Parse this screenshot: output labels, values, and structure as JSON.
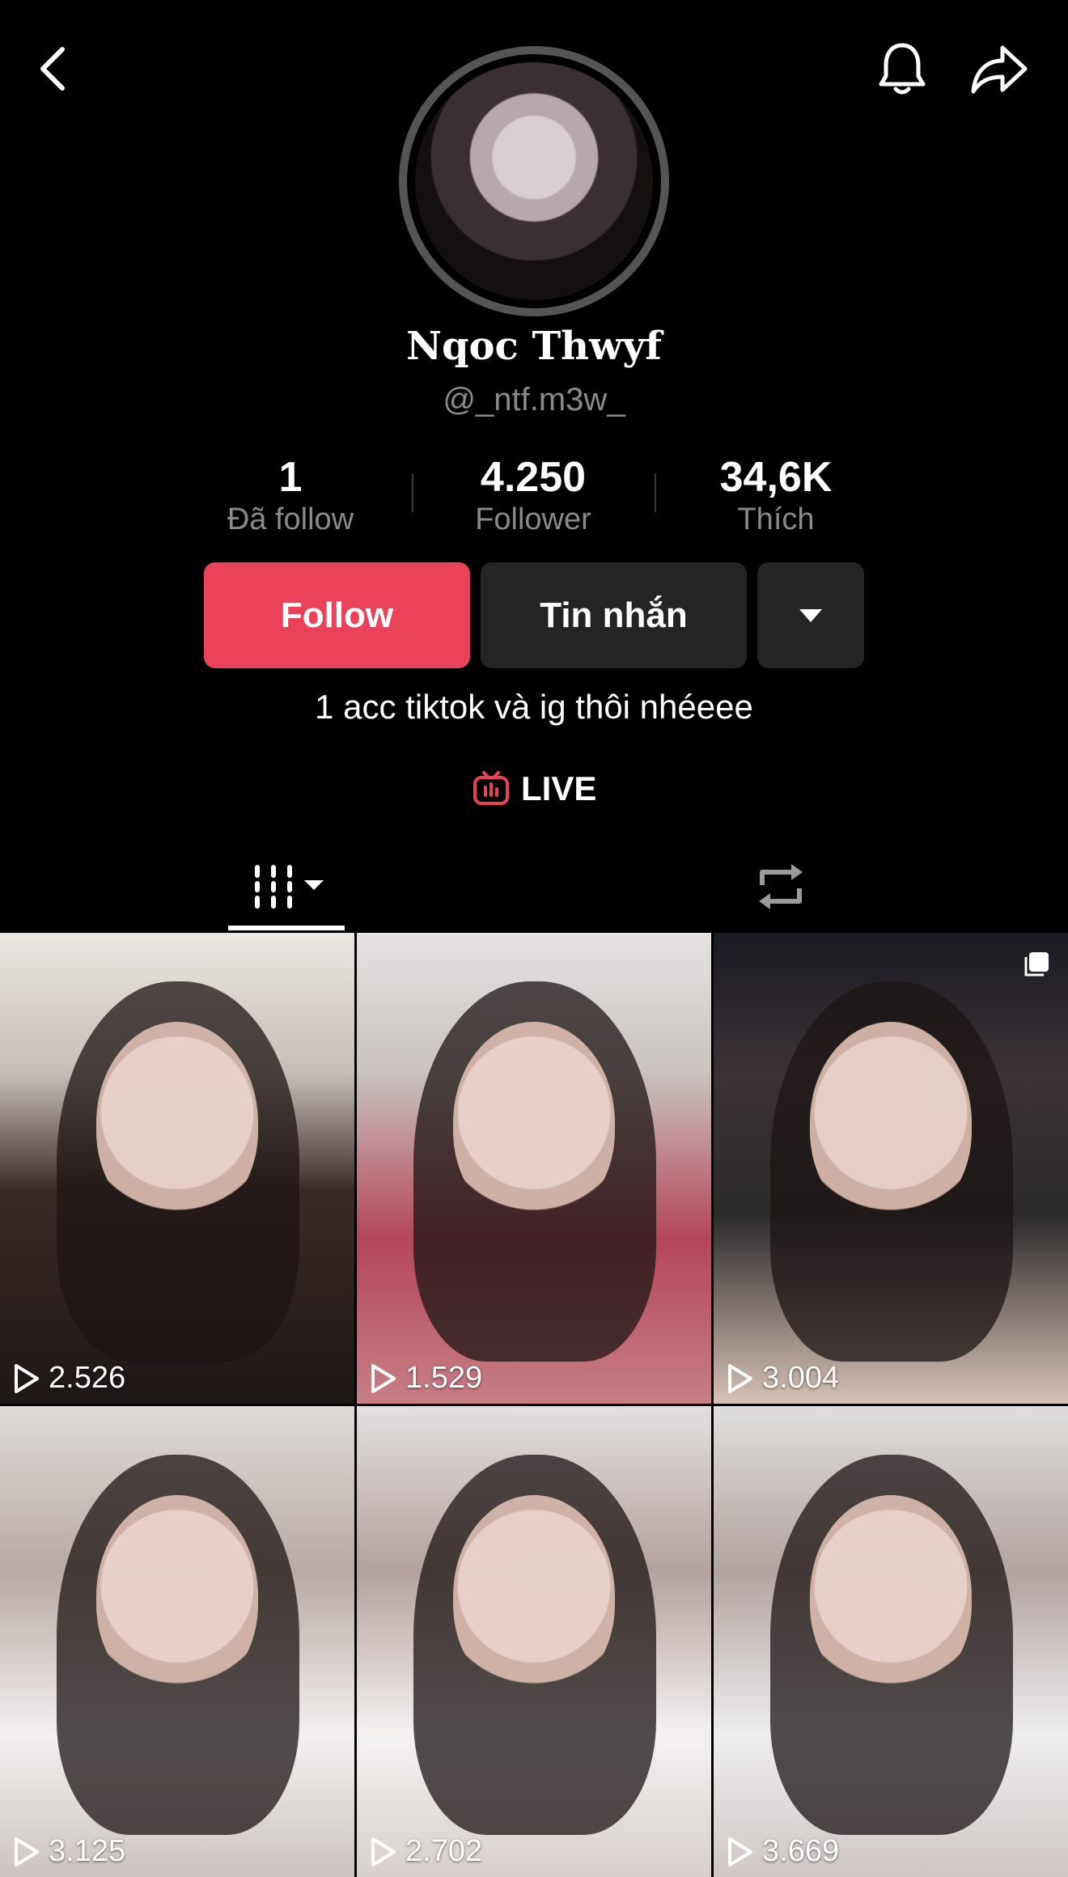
{
  "profile": {
    "display_name": "Nqoc Thwyf",
    "username": "@_ntf.m3w_",
    "bio": "1 acc tiktok và ig thôi nhéeee"
  },
  "stats": [
    {
      "value": "1",
      "label": "Đã follow"
    },
    {
      "value": "4.250",
      "label": "Follower"
    },
    {
      "value": "34,6K",
      "label": "Thích"
    }
  ],
  "actions": {
    "follow_label": "Follow",
    "message_label": "Tin nhắn"
  },
  "live_label": "LIVE",
  "colors": {
    "accent": "#ea4359",
    "background": "#000000",
    "button_dark": "#242424",
    "muted_text": "#8a8a8a"
  },
  "icons": {
    "back": "chevron-left-icon",
    "notifications": "bell-icon",
    "share": "share-arrow-icon",
    "more": "caret-down-icon",
    "live": "tv-icon",
    "videos_tab": "grid-icon",
    "reposts_tab": "repost-icon"
  },
  "videos": [
    {
      "views": "2.526"
    },
    {
      "views": "1.529"
    },
    {
      "views": "3.004",
      "multi": true
    },
    {
      "views": "3.125"
    },
    {
      "views": "2.702"
    },
    {
      "views": "3.669"
    }
  ]
}
